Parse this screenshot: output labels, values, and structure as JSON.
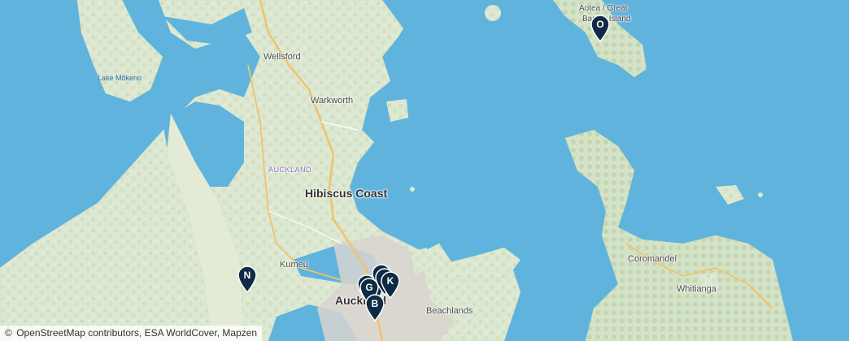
{
  "map": {
    "place_labels": {
      "wellsford": "Wellsford",
      "warkworth": "Warkworth",
      "lake_mokeno": "Lake Mōkeno",
      "auckland_region": "AUCKLAND",
      "hibiscus_coast": "Hibiscus Coast",
      "kumeu": "Kumeū",
      "auckland": "Auckland",
      "beachlands": "Beachlands",
      "coromandel": "Coromandel",
      "whitianga": "Whitianga",
      "great_barrier_line1": "Aotea / Great",
      "great_barrier_line2": "Barrier Island"
    },
    "markers": {
      "o": "O",
      "n": "N",
      "k": "K",
      "b": "B",
      "g": "G",
      "c1": "",
      "c2": "",
      "c3": "",
      "c4": ""
    },
    "marker_color": "#0f2a45",
    "water_color": "#5fb3dd",
    "land_color": "#dfe9d4"
  },
  "attribution": {
    "symbol": "©",
    "text": "OpenStreetMap contributors, ESA WorldCover, Mapzen"
  }
}
